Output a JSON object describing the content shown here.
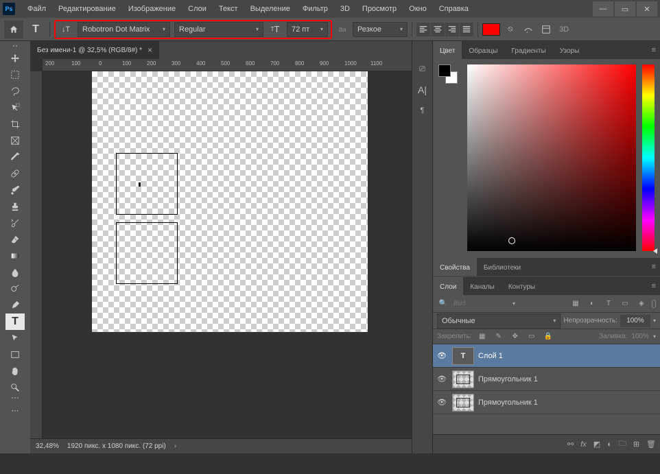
{
  "app": {
    "logo": "Ps"
  },
  "menu": [
    "Файл",
    "Редактирование",
    "Изображение",
    "Слои",
    "Текст",
    "Выделение",
    "Фильтр",
    "3D",
    "Просмотр",
    "Окно",
    "Справка"
  ],
  "options": {
    "font_family": "Robotron Dot Matrix",
    "font_style": "Regular",
    "font_size": "72 пт",
    "antialias": "Резкое"
  },
  "document": {
    "tab_title": "Без имени-1 @ 32,5% (RGB/8#) *",
    "ruler_marks": [
      "200",
      "100",
      "0",
      "100",
      "200",
      "300",
      "400",
      "500",
      "600",
      "700",
      "800",
      "900",
      "1000",
      "1100"
    ]
  },
  "status": {
    "zoom": "32,48%",
    "info": "1920 пикс. x 1080 пикс. (72 ppi)"
  },
  "panels": {
    "color_tabs": [
      "Цвет",
      "Образцы",
      "Градиенты",
      "Узоры"
    ],
    "props_tabs": [
      "Свойства",
      "Библиотеки"
    ],
    "layers_tabs": [
      "Слои",
      "Каналы",
      "Контуры"
    ],
    "search_placeholder": "Вид",
    "blend_mode": "Обычные",
    "opacity_label": "Непрозрачность:",
    "opacity_value": "100%",
    "lock_label": "Закрепить:",
    "fill_label": "Заливка:",
    "fill_value": "100%"
  },
  "layers": [
    {
      "name": "Слой 1",
      "type": "text",
      "selected": true
    },
    {
      "name": "Прямоугольник 1",
      "type": "shape",
      "selected": false
    },
    {
      "name": "Прямоугольник 1",
      "type": "shape",
      "selected": false
    }
  ],
  "colors": {
    "accent_red": "#ff0000"
  }
}
